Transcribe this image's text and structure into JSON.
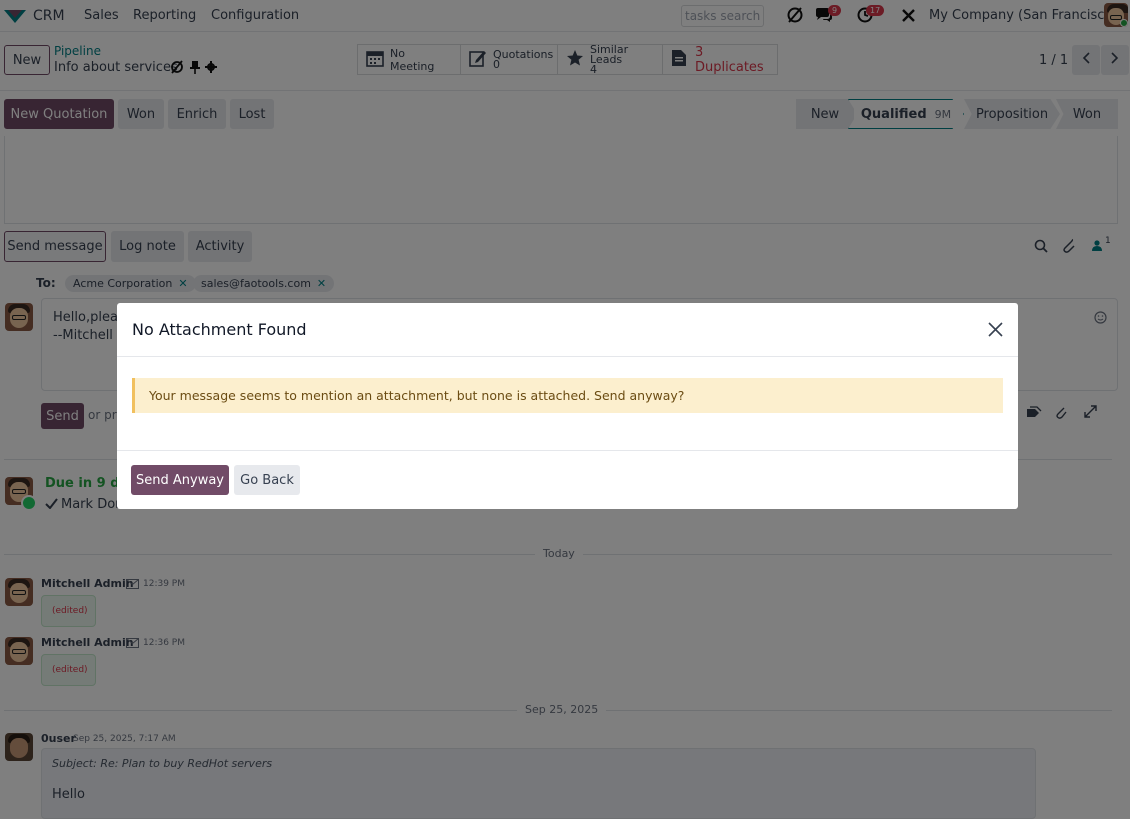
{
  "topnav": {
    "app_name": "CRM",
    "menu": [
      "Sales",
      "Reporting",
      "Configuration"
    ],
    "search_placeholder": "tasks search",
    "messages_count": "9",
    "activities_count": "17",
    "company": "My Company (San Francisco)"
  },
  "control_panel": {
    "new_label": "New",
    "breadcrumb_parent": "Pipeline",
    "record_name": "Info about services",
    "smart_buttons": {
      "meeting": "No Meeting",
      "quotations_label": "Quotations",
      "quotations_count": "0",
      "similar_label": "Similar Leads",
      "similar_count": "4",
      "duplicates": "3 Duplicates"
    },
    "pager": "1 / 1"
  },
  "actions": {
    "new_quotation": "New Quotation",
    "won": "Won",
    "enrich": "Enrich",
    "lost": "Lost"
  },
  "stages": [
    "New",
    "Qualified",
    "Proposition",
    "Won"
  ],
  "stage_duration": "9M",
  "chatter": {
    "tabs": [
      "Send message",
      "Log note",
      "Activity"
    ],
    "followers_count": "1",
    "to_label": "To:",
    "recipients": [
      "Acme Corporation",
      "sales@faotools.com"
    ],
    "draft_line1": "Hello,pleas",
    "draft_line2": "--Mitchell A",
    "send_label": "Send",
    "or_text": "or pre",
    "activity_due": "Due in 9 day",
    "activity_assignee": "Mark Don",
    "today_label": "Today",
    "messages": [
      {
        "author": "Mitchell Admin",
        "time": "12:39 PM",
        "body": "(edited)"
      },
      {
        "author": "Mitchell Admin",
        "time": "12:36 PM",
        "body": "(edited)"
      }
    ],
    "older_date": "Sep 25, 2025",
    "older_msg": {
      "author": "0user",
      "time": "Sep 25, 2025, 7:17 AM",
      "subject": "Subject: Re: Plan to buy RedHot servers",
      "body": "Hello"
    }
  },
  "modal": {
    "title": "No Attachment Found",
    "message": "Your message seems to mention an attachment, but none is attached. Send anyway?",
    "primary": "Send Anyway",
    "secondary": "Go Back"
  },
  "colors": {
    "brand": "#714b67",
    "warning_bg": "#fcefce",
    "danger": "#d9364a",
    "success": "#28a745"
  }
}
